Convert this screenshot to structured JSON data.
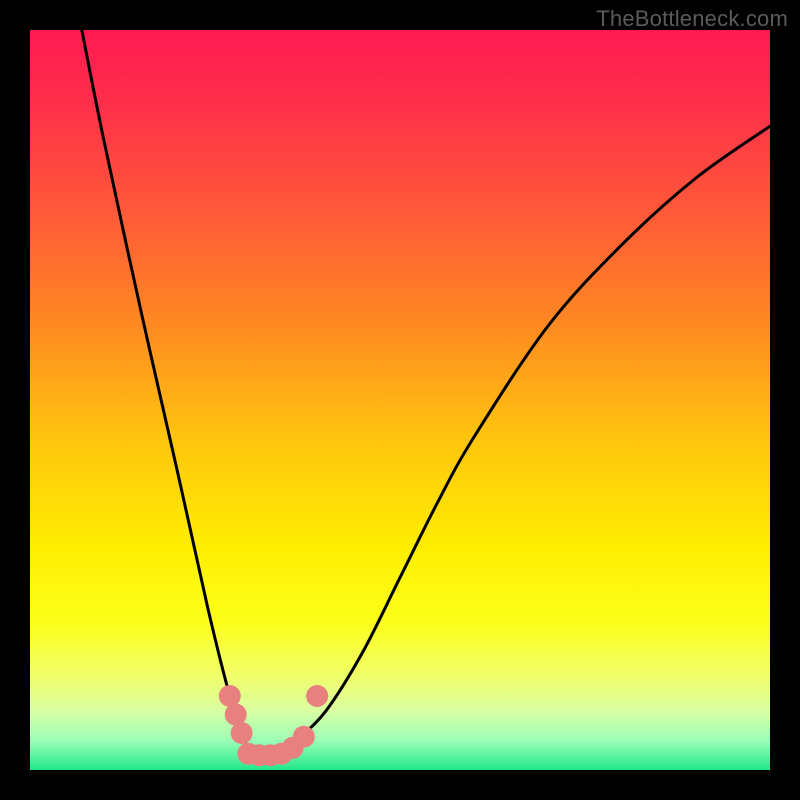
{
  "watermark": "TheBottleneck.com",
  "chart_data": {
    "type": "line",
    "title": "",
    "xlabel": "",
    "ylabel": "",
    "xlim": [
      0,
      100
    ],
    "ylim": [
      0,
      100
    ],
    "grid": false,
    "legend": false,
    "series": [
      {
        "name": "bottleneck-curve",
        "x": [
          7,
          10,
          15,
          20,
          24,
          27,
          29,
          30,
          32,
          34,
          36,
          40,
          45,
          50,
          55,
          60,
          70,
          80,
          90,
          100
        ],
        "values": [
          100,
          85,
          62,
          40,
          22,
          10,
          4,
          2,
          2,
          2,
          4,
          8,
          16,
          26,
          36,
          45,
          60,
          71,
          80,
          87
        ]
      }
    ],
    "markers": [
      {
        "name": "dot",
        "x": 27.0,
        "y": 10.0
      },
      {
        "name": "dot",
        "x": 27.8,
        "y": 7.5
      },
      {
        "name": "dot",
        "x": 28.6,
        "y": 5.0
      },
      {
        "name": "dot",
        "x": 29.5,
        "y": 2.2
      },
      {
        "name": "dot",
        "x": 31.0,
        "y": 2.0
      },
      {
        "name": "dot",
        "x": 32.5,
        "y": 2.0
      },
      {
        "name": "dot",
        "x": 34.0,
        "y": 2.2
      },
      {
        "name": "dot",
        "x": 35.5,
        "y": 3.0
      },
      {
        "name": "dot",
        "x": 37.0,
        "y": 4.5
      },
      {
        "name": "dot",
        "x": 38.8,
        "y": 10.0
      }
    ],
    "gradient_stops": [
      {
        "offset": 0.0,
        "color": "#ff1a52"
      },
      {
        "offset": 0.1,
        "color": "#ff2f4a"
      },
      {
        "offset": 0.25,
        "color": "#ff5a38"
      },
      {
        "offset": 0.4,
        "color": "#ff8a22"
      },
      {
        "offset": 0.55,
        "color": "#ffc40e"
      },
      {
        "offset": 0.7,
        "color": "#ffee02"
      },
      {
        "offset": 0.8,
        "color": "#fcff1a"
      },
      {
        "offset": 0.87,
        "color": "#f2ff66"
      },
      {
        "offset": 0.92,
        "color": "#d9ffa3"
      },
      {
        "offset": 0.96,
        "color": "#9cffb8"
      },
      {
        "offset": 1.0,
        "color": "#20e88a"
      }
    ],
    "marker_color": "#e98080",
    "curve_color": "#000000"
  }
}
